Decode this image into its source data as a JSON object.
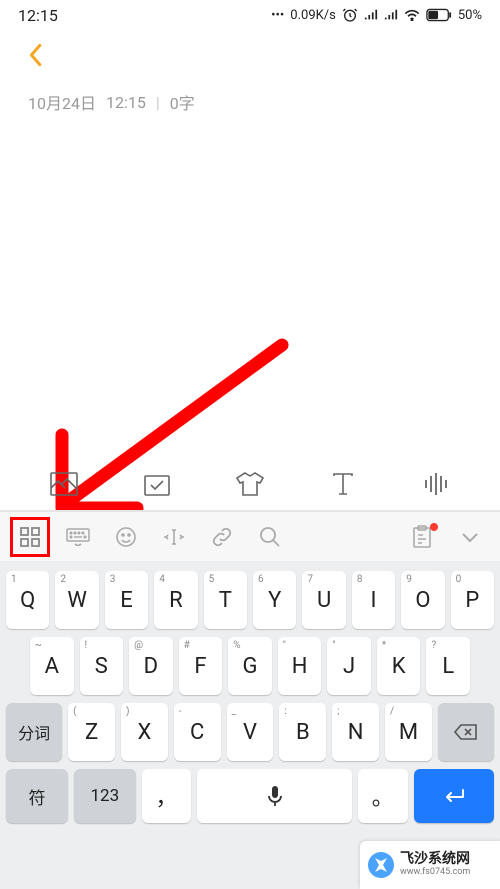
{
  "status": {
    "time": "12:15",
    "netSpeed": "0.09K/s",
    "battery": "50%"
  },
  "meta": {
    "date": "10月24日",
    "time": "12:15",
    "wordCount": "0字"
  },
  "formatBar": {
    "items": [
      "image",
      "checklist",
      "shirt",
      "text",
      "voice"
    ]
  },
  "inputToolbar": {
    "items": [
      "grid",
      "keyboard",
      "emoji",
      "cursor",
      "link",
      "search",
      "clipboard",
      "collapse"
    ]
  },
  "keyboard": {
    "row1": [
      {
        "n": "1",
        "m": "Q"
      },
      {
        "n": "2",
        "m": "W"
      },
      {
        "n": "3",
        "m": "E"
      },
      {
        "n": "4",
        "m": "R"
      },
      {
        "n": "5",
        "m": "T"
      },
      {
        "n": "6",
        "m": "Y"
      },
      {
        "n": "7",
        "m": "U"
      },
      {
        "n": "8",
        "m": "I"
      },
      {
        "n": "9",
        "m": "O"
      },
      {
        "n": "0",
        "m": "P"
      }
    ],
    "row2": [
      {
        "s": "~",
        "m": "A"
      },
      {
        "s": "!",
        "m": "S"
      },
      {
        "s": "@",
        "m": "D"
      },
      {
        "s": "#",
        "m": "F"
      },
      {
        "s": "%",
        "m": "G"
      },
      {
        "s": "\"",
        "m": "H"
      },
      {
        "s": "\"",
        "m": "J"
      },
      {
        "s": "*",
        "m": "K"
      },
      {
        "s": "?",
        "m": "L"
      }
    ],
    "row3Shift": "分词",
    "row3": [
      {
        "s": "(",
        "m": "Z"
      },
      {
        "s": ")",
        "m": "X"
      },
      {
        "s": "-",
        "m": "C"
      },
      {
        "s": "_",
        "m": "V"
      },
      {
        "s": ":",
        "m": "B"
      },
      {
        "s": ";",
        "m": "N"
      },
      {
        "s": "/",
        "m": "M"
      }
    ],
    "row4": {
      "sym": "符",
      "num": "123",
      "comma": "，",
      "period": "。"
    }
  },
  "watermark": {
    "title": "飞沙系统网",
    "url": "www.fs0745.com"
  }
}
